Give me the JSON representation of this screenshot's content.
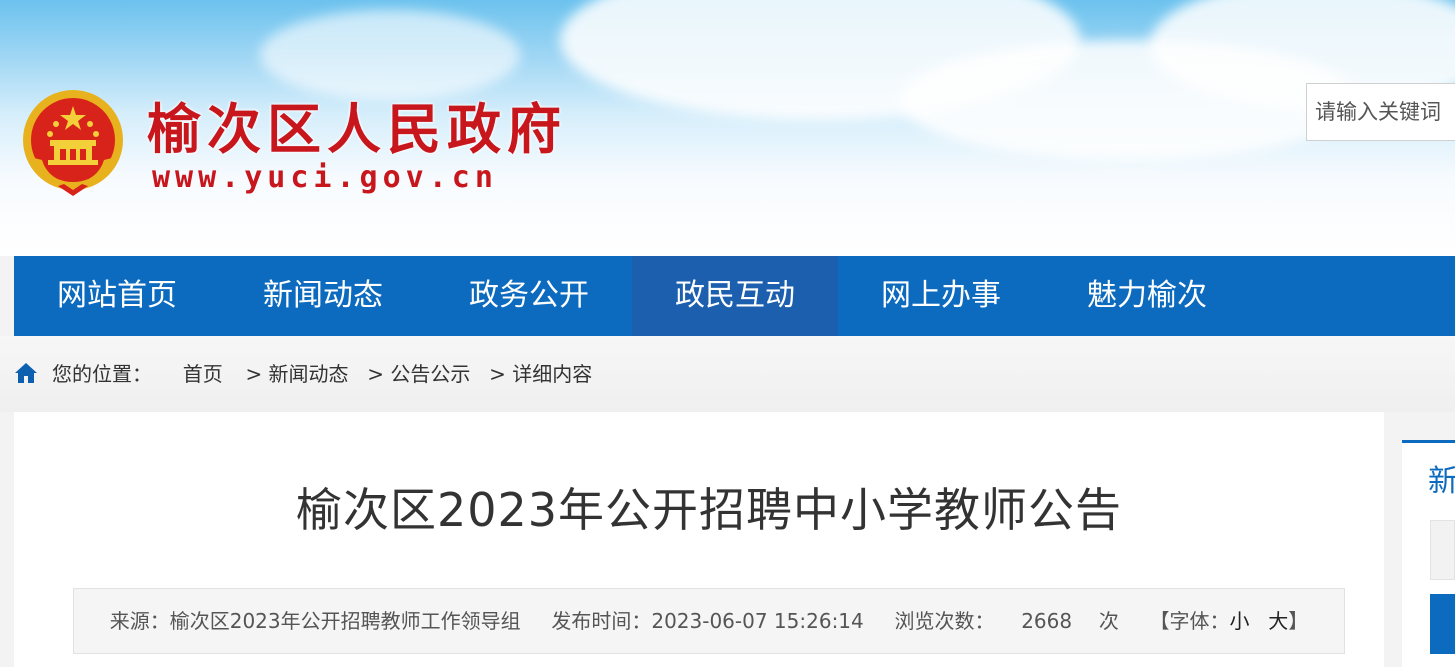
{
  "header": {
    "site_title": "榆次区人民政府",
    "site_url": "www.yuci.gov.cn",
    "search_placeholder": "请输入关键词"
  },
  "nav": {
    "items": [
      {
        "label": "网站首页"
      },
      {
        "label": "新闻动态"
      },
      {
        "label": "政务公开"
      },
      {
        "label": "政民互动"
      },
      {
        "label": "网上办事"
      },
      {
        "label": "魅力榆次"
      }
    ],
    "active_index": 3
  },
  "breadcrumb": {
    "prefix": "您的位置：",
    "items": [
      "首页",
      "> 新闻动态",
      "> 公告公示",
      "> 详细内容"
    ]
  },
  "article": {
    "title": "榆次区2023年公开招聘中小学教师公告",
    "source_label": "来源：",
    "source": "榆次区2023年公开招聘教师工作领导组",
    "publish_label": "发布时间：",
    "publish_time": "2023-06-07 15:26:14",
    "views_label": "浏览次数：",
    "views": "2668",
    "views_unit": "次",
    "font_label": "【字体：",
    "font_small": "小",
    "font_large": "大",
    "font_close": "】"
  },
  "sidebar": {
    "title_partial": "新"
  },
  "colors": {
    "brand_red": "#c8161d",
    "nav_blue": "#0d6bbf",
    "nav_active": "#1b5fae"
  },
  "icons": [
    "national-emblem-icon",
    "home-icon"
  ]
}
